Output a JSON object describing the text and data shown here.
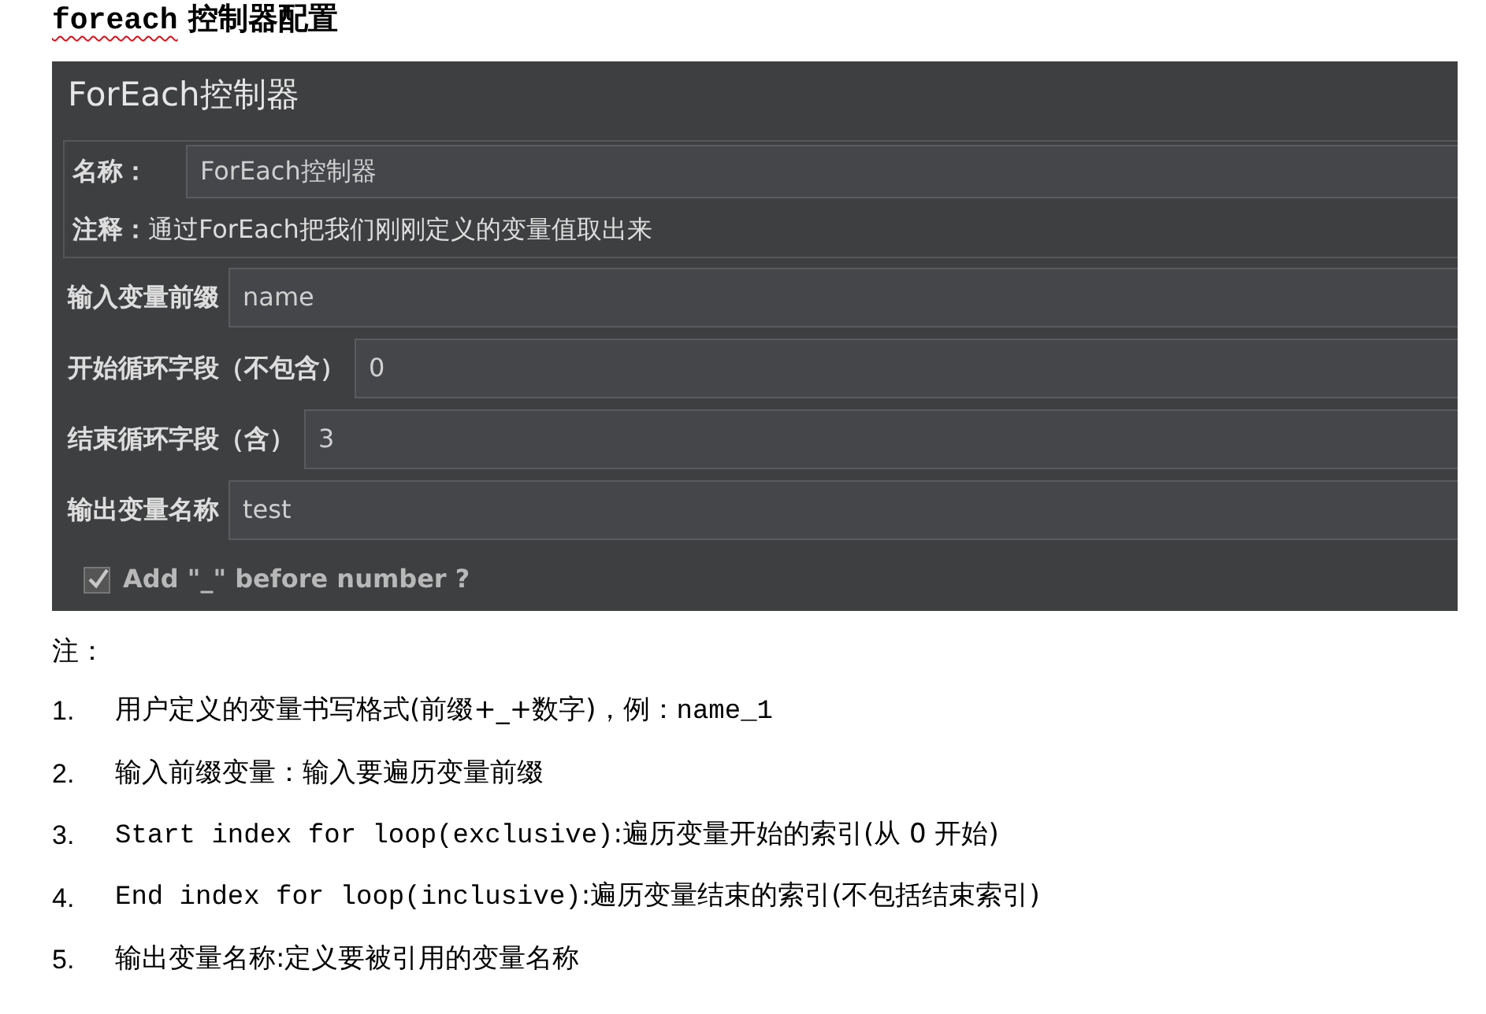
{
  "heading": [
    {
      "kind": "code",
      "text": "foreach",
      "misspelled": true
    },
    {
      "kind": "text",
      "text": "控制器配置",
      "misspelled": false
    }
  ],
  "panel": {
    "title": "ForEach控制器",
    "name_label": "名称：",
    "name_value": "ForEach控制器",
    "comment_label": "注释：",
    "comment": "通过ForEach把我们刚刚定义的变量值取出来",
    "fields": [
      {
        "label": "输入变量前缀",
        "value": "name"
      },
      {
        "label": "开始循环字段（不包含）",
        "value": "0"
      },
      {
        "label": "结束循环字段（含）",
        "value": "3"
      },
      {
        "label": "输出变量名称",
        "value": "test"
      }
    ],
    "checkbox": {
      "label": "Add \"_\" before number ?",
      "checked": true
    }
  },
  "notes": {
    "title": "注：",
    "items": [
      {
        "number": "1.",
        "segments": [
          {
            "kind": "text",
            "text": "用户定义的变量书写格式(前缀+_+数字)，例："
          },
          {
            "kind": "code",
            "text": "name_1"
          }
        ]
      },
      {
        "number": "2.",
        "segments": [
          {
            "kind": "text",
            "text": "输入前缀变量：输入要遍历变量前缀"
          }
        ]
      },
      {
        "number": "3.",
        "segments": [
          {
            "kind": "code",
            "text": "Start index for loop(exclusive)"
          },
          {
            "kind": "text",
            "text": ":遍历变量开始的索引(从 0 开始)"
          }
        ]
      },
      {
        "number": "4.",
        "segments": [
          {
            "kind": "code",
            "text": "End index for loop(inclusive)"
          },
          {
            "kind": "text",
            "text": ":遍历变量结束的索引(不包括结束索引)"
          }
        ]
      },
      {
        "number": "5.",
        "segments": [
          {
            "kind": "text",
            "text": "输出变量名称:定义要被引用的变量名称"
          }
        ]
      }
    ]
  }
}
